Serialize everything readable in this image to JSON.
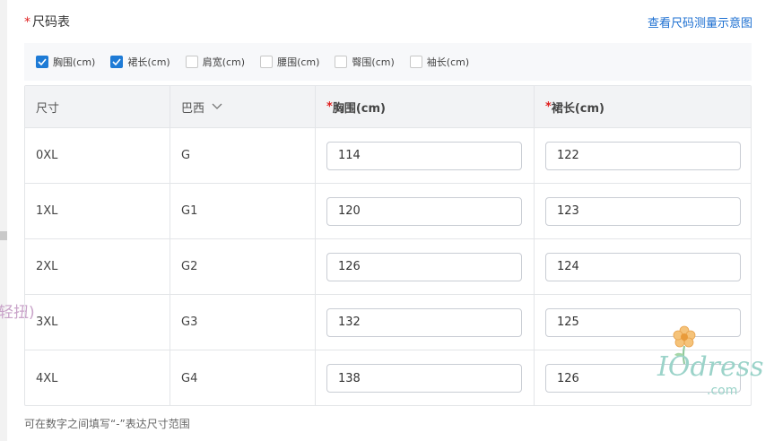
{
  "header": {
    "required_mark": "*",
    "title": "尺码表",
    "link": "查看尺码测量示意图"
  },
  "filters": [
    {
      "label": "胸围(cm)",
      "checked": true
    },
    {
      "label": "裙长(cm)",
      "checked": true
    },
    {
      "label": "肩宽(cm)",
      "checked": false
    },
    {
      "label": "腰围(cm)",
      "checked": false
    },
    {
      "label": "臀围(cm)",
      "checked": false
    },
    {
      "label": "袖长(cm)",
      "checked": false
    }
  ],
  "table": {
    "headers": {
      "size": "尺寸",
      "region": "巴西",
      "chest": "胸围(cm)",
      "length": "裙长(cm)",
      "required_mark": "*"
    },
    "rows": [
      {
        "size": "0XL",
        "region": "G",
        "chest": "114",
        "length": "122"
      },
      {
        "size": "1XL",
        "region": "G1",
        "chest": "120",
        "length": "123"
      },
      {
        "size": "2XL",
        "region": "G2",
        "chest": "126",
        "length": "124"
      },
      {
        "size": "3XL",
        "region": "G3",
        "chest": "132",
        "length": "125"
      },
      {
        "size": "4XL",
        "region": "G4",
        "chest": "138",
        "length": "126"
      }
    ]
  },
  "hint": "可在数字之间填写“-”表达尺寸范围",
  "left_ghost_text": "轻扭)",
  "watermark": {
    "main": "IOdress",
    "sub": ".com"
  },
  "colors": {
    "accent": "#1e7bd6",
    "link": "#1c6fd1",
    "required": "#e02020"
  },
  "icons": {
    "checkbox_checked": "check-icon",
    "region_dropdown": "chevron-down-icon",
    "watermark_flower": "flower-icon"
  }
}
